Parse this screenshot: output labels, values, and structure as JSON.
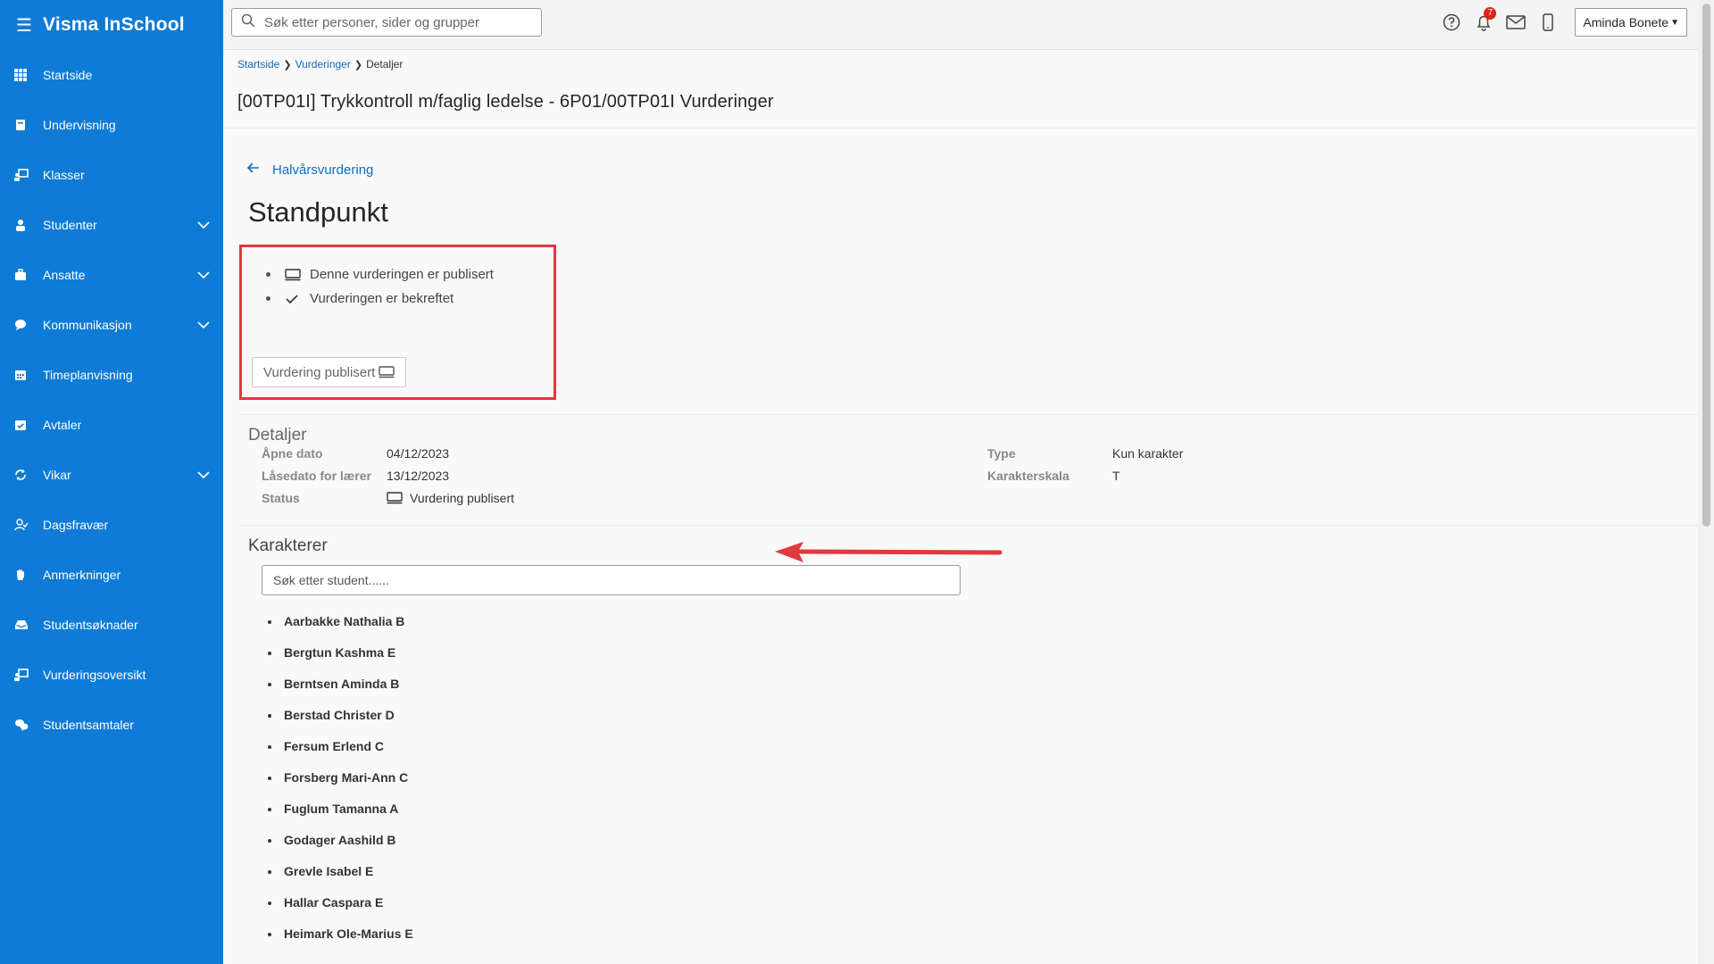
{
  "app": {
    "title": "Visma InSchool"
  },
  "sidebar": {
    "items": [
      {
        "label": "Startside",
        "icon": "grid-icon",
        "chevron": false
      },
      {
        "label": "Undervisning",
        "icon": "book-icon",
        "chevron": false
      },
      {
        "label": "Klasser",
        "icon": "classroom-icon",
        "chevron": false
      },
      {
        "label": "Studenter",
        "icon": "student-icon",
        "chevron": true
      },
      {
        "label": "Ansatte",
        "icon": "briefcase-icon",
        "chevron": true
      },
      {
        "label": "Kommunikasjon",
        "icon": "chat-icon",
        "chevron": true
      },
      {
        "label": "Timeplanvisning",
        "icon": "calendar-icon",
        "chevron": false
      },
      {
        "label": "Avtaler",
        "icon": "calendar-check-icon",
        "chevron": false
      },
      {
        "label": "Vikar",
        "icon": "refresh-icon",
        "chevron": true
      },
      {
        "label": "Dagsfravær",
        "icon": "user-check-icon",
        "chevron": false
      },
      {
        "label": "Anmerkninger",
        "icon": "hand-icon",
        "chevron": false
      },
      {
        "label": "Studentsøknader",
        "icon": "inbox-icon",
        "chevron": false
      },
      {
        "label": "Vurderingsoversikt",
        "icon": "assessment-icon",
        "chevron": false
      },
      {
        "label": "Studentsamtaler",
        "icon": "conversation-icon",
        "chevron": false
      }
    ]
  },
  "topbar": {
    "search_placeholder": "Søk etter personer, sider og grupper",
    "notification_count": "7",
    "user_name": "Aminda Bonete"
  },
  "breadcrumb": {
    "items": [
      "Startside",
      "Vurderinger"
    ],
    "current": "Detaljer"
  },
  "page": {
    "title": "[00TP01I] Trykkontroll m/faglig ledelse - 6P01/00TP01I Vurderinger",
    "back_link": "Halvårsvurdering",
    "section_title": "Standpunkt",
    "status_items": [
      "Denne vurderingen er publisert",
      "Vurderingen er bekreftet"
    ],
    "publish_button": "Vurdering publisert"
  },
  "details": {
    "title": "Detaljer",
    "open_date_label": "Åpne dato",
    "open_date": "04/12/2023",
    "lock_date_label": "Låsedato for lærer",
    "lock_date": "13/12/2023",
    "status_label": "Status",
    "status": "Vurdering publisert",
    "type_label": "Type",
    "type": "Kun karakter",
    "scale_label": "Karakterskala",
    "scale": "T"
  },
  "grades": {
    "title": "Karakterer",
    "search_placeholder": "Søk etter student......",
    "students": [
      "Aarbakke Nathalia B",
      "Bergtun Kashma E",
      "Berntsen Aminda B",
      "Berstad Christer D",
      "Fersum Erlend C",
      "Forsberg Mari-Ann C",
      "Fuglum Tamanna A",
      "Godager Aashild B",
      "Grevle Isabel E",
      "Hallar Caspara E",
      "Heimark Ole-Marius E"
    ]
  },
  "colors": {
    "sidebar": "#0e7bd6",
    "link": "#0e6cc1",
    "highlight": "#e0393e",
    "badge": "#d9251c"
  }
}
